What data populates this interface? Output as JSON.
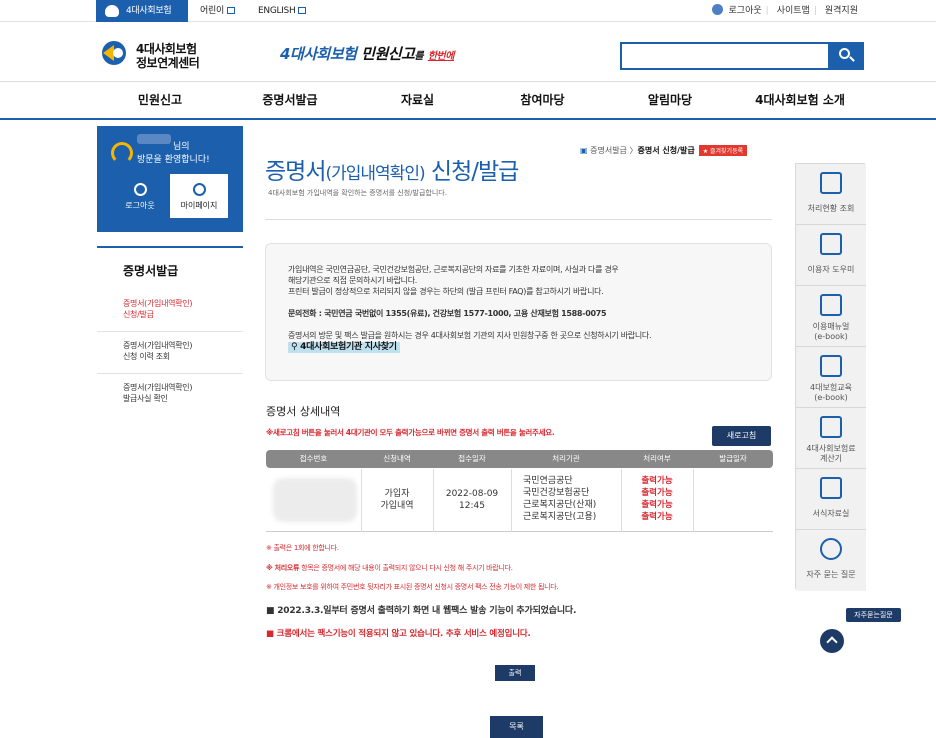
{
  "topbar": {
    "tabs": [
      {
        "label": "4대사회보험"
      },
      {
        "label": "어린이"
      },
      {
        "label": "ENGLISH"
      }
    ],
    "utils": {
      "logout": "로그아웃",
      "sitemap": "사이트맵",
      "remote": "원격지원"
    }
  },
  "header": {
    "logo_line1": "4대사회보험",
    "logo_line2": "정보연계센터",
    "slogan_blue": "4대사회보험",
    "slogan_black": " 민원신고",
    "slogan_small": "를",
    "slogan_red": "한번에",
    "search_placeholder": ""
  },
  "gnb": [
    "민원신고",
    "증명서발급",
    "자료실",
    "참여마당",
    "알림마당",
    "4대사회보험 소개"
  ],
  "sidebar": {
    "user_suffix": "님의",
    "welcome": "방문을 환영합니다!",
    "logout_label": "로그아웃",
    "mypage_label": "마이페이지",
    "section_title": "증명서발급",
    "items": [
      {
        "label1": "증명서(가입내역확인)",
        "label2": "신청/발급"
      },
      {
        "label1": "증명서(가입내역확인)",
        "label2": "신청 이력 조회"
      },
      {
        "label1": "증명서(가입내역확인)",
        "label2": "발급사실 확인"
      }
    ]
  },
  "page": {
    "title_part1": "증명서",
    "title_part2": "(가입내역확인)",
    "title_part3": " 신청/발급",
    "subtitle": "4대사회보험 가입내역을 확인하는 증명서를 신청/발급합니다.",
    "crumb_prev": "증명서발급",
    "crumb_current": "증명서 신청/발급",
    "favorite": "즐겨찾기등록"
  },
  "info": {
    "line1": "가입내역은 국민연금공단, 국민건강보험공단, 근로복지공단의 자료를 기초한 자료이며, 사실과 다를 경우",
    "line2": "해당기관으로 직접 문의하시기 바랍니다.",
    "line3": "프린터 발급이 정상적으로 처리되지 않을 경우는 하단의 (발급 프린터 FAQ)를 참고하시기 바랍니다.",
    "phone": "문의전화 : 국민연금 국번없이 1355(유료), 건강보험 1577-1000, 고용 산재보험 1588-0075",
    "line4": "증명서의 방문 및 팩스 발급을 원하시는 경우 4대사회보험 기관의 지사 민원창구중 한 곳으로 신청하시기 바랍니다.",
    "find_link": "4대사회보험기관 지사찾기"
  },
  "detail": {
    "title": "증명서 상세내역",
    "note": "※새로고침 버튼을 눌러서 4대기관이 모두 출력가능으로 바뀌면 증명서 출력 버튼을 눌러주세요.",
    "refresh_label": "새로고침",
    "columns": [
      "접수번호",
      "신청내역",
      "접수일자",
      "처리기관",
      "처리여부",
      "발급일자"
    ],
    "row": {
      "type1": "가입자",
      "type2": "가입내역",
      "date": "2022-08-09",
      "time": "12:45",
      "agencies": [
        "국민연금공단",
        "국민건강보험공단",
        "근로복지공단(산재)",
        "근로복지공단(고용)"
      ],
      "statuses": [
        "출력가능",
        "출력가능",
        "출력가능",
        "출력가능"
      ]
    }
  },
  "notes": {
    "n1": "※ 출력은 1회에 한합니다.",
    "n2_bold": "※ 처리오류",
    "n2_rest": " 항목은 증명서에 해당 내용이 출력되지 않으니 다시 신청 해 주시기 바랍니다.",
    "n3": "※ 개인정보 보호를 위하여 주민번호 뒷자리가 표시된 증명서 신청시 증명서 팩스 전송 기능이 제한 됩니다.",
    "n4": "■ 2022.3.3.일부터 증명서 출력하기 화면 내 웹팩스 발송 기능이 추가되었습니다.",
    "n5": "■ 크롬에서는 팩스기능이 적용되지 않고 있습니다. 추후 서비스 예정입니다."
  },
  "buttons": {
    "print": "출력",
    "list": "목록"
  },
  "quickmenu": [
    {
      "label1": "처리현황 조회",
      "label2": "",
      "icon": "document-icon"
    },
    {
      "label1": "이용자 도우미",
      "label2": "",
      "icon": "help-monitor-icon"
    },
    {
      "label1": "이용매뉴얼",
      "label2": "(e-book)",
      "icon": "manual-icon"
    },
    {
      "label1": "4대보험교육",
      "label2": "(e-book)",
      "icon": "book-icon"
    },
    {
      "label1": "4대사회보험료",
      "label2": "계산기",
      "icon": "calculator-icon"
    },
    {
      "label1": "서식자료실",
      "label2": "",
      "icon": "form-icon"
    },
    {
      "label1": "자주 묻는 질문",
      "label2": "",
      "icon": "faq-icon"
    }
  ],
  "faq_button": "자주묻는질문",
  "colors": {
    "brand": "#1b5fad",
    "dark": "#1e3a66",
    "alert": "#d7282f",
    "status": "#d7282f"
  }
}
